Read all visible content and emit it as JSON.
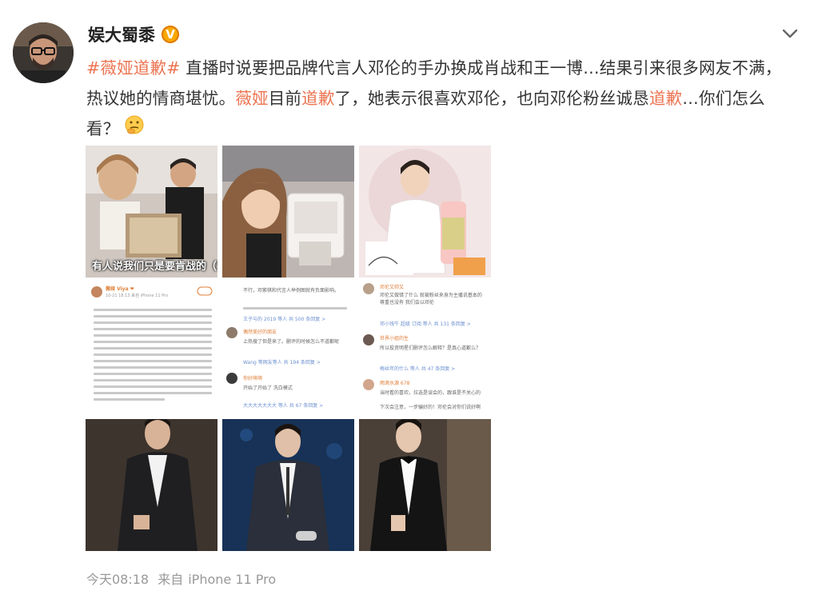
{
  "post": {
    "author": "娱大蜀黍",
    "verified_badge": "V",
    "text": {
      "tag1": "#薇娅道歉#",
      "seg1": " 直播时说要把品牌代言人邓伦的手办换成肖战和王一博…结果引来很多网友不满，热议她的情商堪忧。",
      "hl1": "薇娅",
      "seg2": "目前",
      "hl2": "道歉",
      "seg3": "了，她表示很喜欢邓伦，也向邓伦粉丝诚恳",
      "hl3": "道歉",
      "seg4": "…你们怎么看？"
    },
    "highlight_color": "#eb7350",
    "images": {
      "img1_caption": "有人说我们只是要肯战的（手",
      "img4_user": "薇娅 Viya ❤",
      "img4_time": "10-21 18:13 来自 iPhone 11 Pro",
      "img5_top": "不行，邓紫棋和代言人举例图就有负面影响。",
      "img5_link1": "王子与的 2019 等人 共 500 条回复 >",
      "img5_user2": "偶然美好的朋友",
      "img5_line2": "上热搜了但是来了。删评的时候怎么不道歉呢",
      "img5_link2": "Wang 等网友等人 共 194 条回复 >",
      "img5_user3": "你好萌萌",
      "img5_line3": "开始了开始了 洗白模式",
      "img5_link3": "大大大大大大大 等人 共 67 条回复 >",
      "img6_user1": "邓伦又帅又",
      "img6_line1": "邓伦又做错了什么 就被粉丝来身为主播说基本的尊重也没有 我们会以邓伦",
      "img6_link1": "邓小钱牛 超级 订阅 等人 共 131 条回复 >",
      "img6_user2": "世界小姐的生",
      "img6_line2": "所以投资明星们删评怎么解释？是真心道歉么？",
      "img6_link2": "梅丝年的什么 等人 共 47 条回复 >",
      "img6_user3": "雨滴水源 678",
      "img6_line3": "当时看的喜欢，拉选是误会的，跟谁是不关心的",
      "img6_line3b": "下次会注意，一步骗好的！邓伦会对你们说好啊"
    },
    "footer": {
      "time": "今天08:18",
      "source_prefix": "来自",
      "source": "iPhone 11 Pro"
    }
  }
}
